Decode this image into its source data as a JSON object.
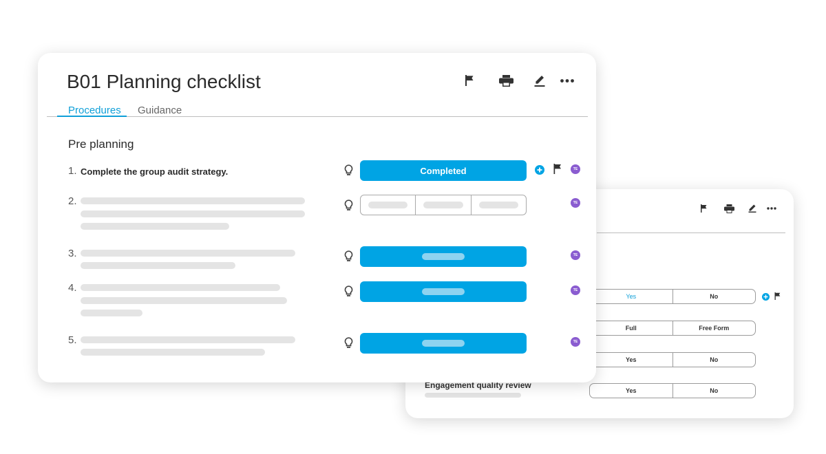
{
  "back_card": {
    "toolbar_icons": [
      "flag-icon",
      "print-icon",
      "edit-icon",
      "more-icon"
    ],
    "rows": [
      {
        "options": [
          "Yes",
          "No"
        ],
        "selected": "Yes"
      },
      {
        "options": [
          "Full",
          "Free Form"
        ],
        "selected": null
      },
      {
        "options": [
          "Yes",
          "No"
        ],
        "selected": null
      },
      {
        "options": [
          "Yes",
          "No"
        ],
        "selected": null
      }
    ],
    "engagement_label": "Engagement quality review"
  },
  "front_card": {
    "title": "B01 Planning checklist",
    "toolbar_icons": [
      "flag-icon",
      "print-icon",
      "edit-icon",
      "more-icon"
    ],
    "tabs": [
      {
        "label": "Procedures",
        "active": true
      },
      {
        "label": "Guidance",
        "active": false
      }
    ],
    "section_heading": "Pre planning",
    "procedures": [
      {
        "number": "1.",
        "text": "Complete the group audit strategy.",
        "status": "Completed",
        "assignee": "TE"
      },
      {
        "number": "2.",
        "text": "",
        "status": "",
        "assignee": "TE"
      },
      {
        "number": "3.",
        "text": "",
        "status": "",
        "assignee": "TE"
      },
      {
        "number": "4.",
        "text": "",
        "status": "",
        "assignee": "TE"
      },
      {
        "number": "5.",
        "text": "",
        "status": "",
        "assignee": "TE"
      }
    ]
  },
  "colors": {
    "accent": "#00a4e4",
    "tab_active": "#0e9fd8",
    "avatar": "#8a5cd0",
    "skeleton": "#e4e4e4"
  }
}
